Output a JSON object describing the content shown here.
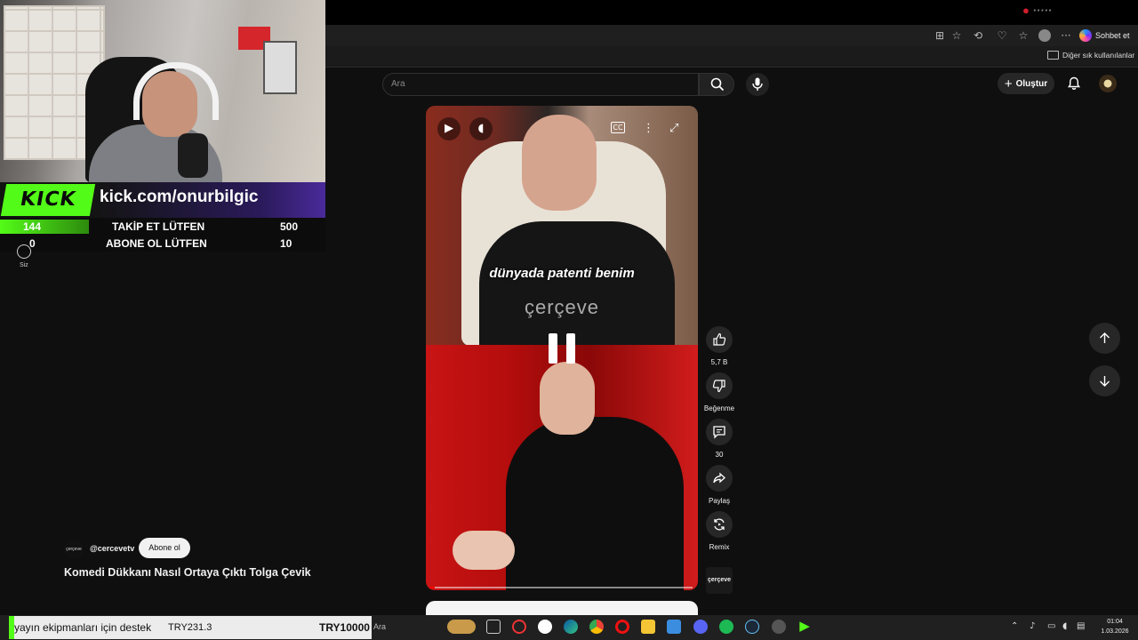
{
  "browser": {
    "chat_label": "Sohbet et",
    "bookmarks_folder": "Diğer sık kullanılanlar"
  },
  "webcam_overlay": {
    "kick_logo": "KICK",
    "kick_url": "kick.com/onurbilgic",
    "follow": {
      "current": "144",
      "label": "TAKİP ET LÜTFEN",
      "goal": "500"
    },
    "subscribe": {
      "current": "0",
      "label": "ABONE OL LÜTFEN",
      "goal": "10"
    }
  },
  "sidebar": {
    "you_label": "Siz"
  },
  "header": {
    "search_placeholder": "Ara",
    "create_label": "Oluştur"
  },
  "video": {
    "subtitle": "dünyada patenti benim",
    "watermark": "çerçeve",
    "progress": 0.02
  },
  "actions": {
    "like_count": "5,7 B",
    "dislike_label": "Beğenme",
    "comment_count": "30",
    "share_label": "Paylaş",
    "remix_label": "Remix",
    "channel_thumb": "çerçeve"
  },
  "channel": {
    "avatar_text": "çerçeve",
    "handle": "@cercevetv",
    "subscribe_label": "Abone ol",
    "title": "Komedi Dükkanı Nasıl Ortaya Çıktı Tolga Çevik"
  },
  "donation": {
    "text": "yayın ekipmanları için destek",
    "amount": "TRY231.3",
    "goal": "TRY10000"
  },
  "taskbar": {
    "search_label": "Ara",
    "time": "01:04",
    "date": "1.03.2026"
  },
  "colors": {
    "kick_green": "#53fc18",
    "youtube_bg": "#0f0f0f",
    "accent_red": "#d21f2b"
  }
}
